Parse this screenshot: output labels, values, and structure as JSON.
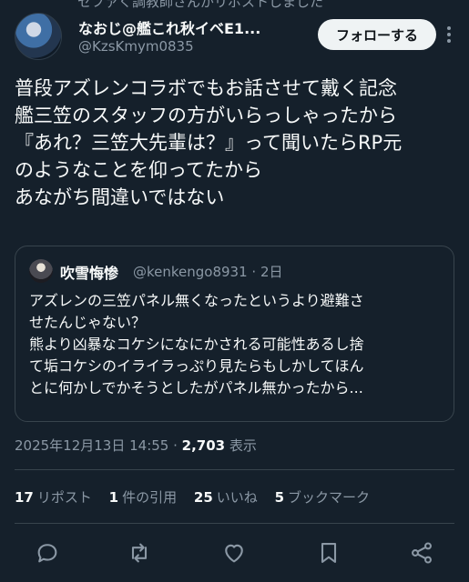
{
  "top_cut_text": "セファく調教師さんがリポストしました",
  "author": {
    "display_name": "なおじ@艦これ秋イベE1...",
    "handle": "@KzsKmym0835"
  },
  "follow_label": "フォローする",
  "post_lines": [
    "普段アズレンコラボでもお話させて戴く記念",
    "艦三笠のスタッフの方がいらっしゃったから",
    "『あれ？三笠大先輩は？』って聞いたらRP元",
    "のようなことを仰ってたから",
    "あながち間違いではない"
  ],
  "quoted": {
    "display_name": "吹雪悔惨",
    "handle": "@kenkengo8931",
    "time": "2日",
    "lines": [
      "アズレンの三笠パネル無くなったというより避難さ",
      "せたんじゃない？",
      "熊より凶暴なコケシになにかされる可能性あるし捨",
      "て垢コケシのイライラっぷり見たらもしかしてほん",
      "とに何かしでかそうとしたがパネル無かったから..."
    ]
  },
  "timestamp": "2025年12月13日 14:55",
  "views_count": "2,703",
  "views_label": "表示",
  "stats": [
    {
      "count": "17",
      "label": "リポスト"
    },
    {
      "count": "1",
      "label": "件の引用"
    },
    {
      "count": "25",
      "label": "いいね"
    },
    {
      "count": "5",
      "label": "ブックマーク"
    }
  ],
  "actions": [
    "reply-icon",
    "repost-icon",
    "like-icon",
    "bookmark-icon",
    "share-icon"
  ]
}
